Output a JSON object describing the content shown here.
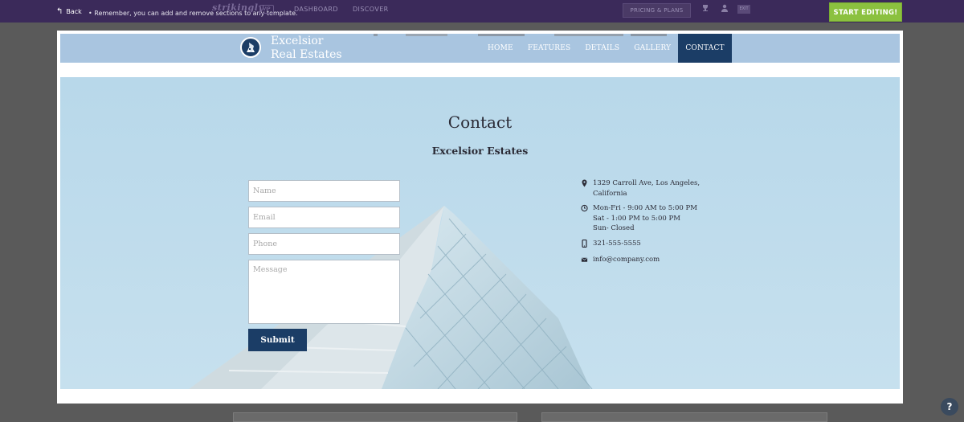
{
  "editor_bar": {
    "back_label": "Back",
    "message": "•  Remember, you can add and remove sections to any template.",
    "logo_text": "strikingly",
    "vip_label": "VIP",
    "nav": [
      "DASHBOARD",
      "DISCOVER"
    ],
    "pricing_label": "PRICING & PLANS",
    "exit_label": "EXIT",
    "start_editing_label": "START EDITING!"
  },
  "site": {
    "brand_line1": "Excelsior",
    "brand_line2": "Real Estates",
    "nav": [
      {
        "label": "HOME",
        "active": false
      },
      {
        "label": "FEATURES",
        "active": false
      },
      {
        "label": "DETAILS",
        "active": false
      },
      {
        "label": "GALLERY",
        "active": false
      },
      {
        "label": "CONTACT",
        "active": true
      }
    ]
  },
  "contact": {
    "title": "Contact",
    "subtitle": "Excelsior Estates",
    "form": {
      "name_placeholder": "Name",
      "email_placeholder": "Email",
      "phone_placeholder": "Phone",
      "message_placeholder": "Message",
      "submit_label": "Submit"
    },
    "info": {
      "address": "1329 Carroll Ave, Los Angeles,\nCalifornia",
      "hours": "Mon-Fri - 9:00 AM to 5:00 PM\nSat - 1:00 PM to 5:00 PM\nSun- Closed",
      "phone": "321-555-5555",
      "email": "info@company.com"
    }
  },
  "help_label": "?",
  "colors": {
    "editor_bar": "#3b2a5a",
    "start_button": "#8bc13f",
    "site_header": "#a9c5e0",
    "accent_navy": "#1b3d66",
    "section_bg": "#b7d7e9"
  }
}
